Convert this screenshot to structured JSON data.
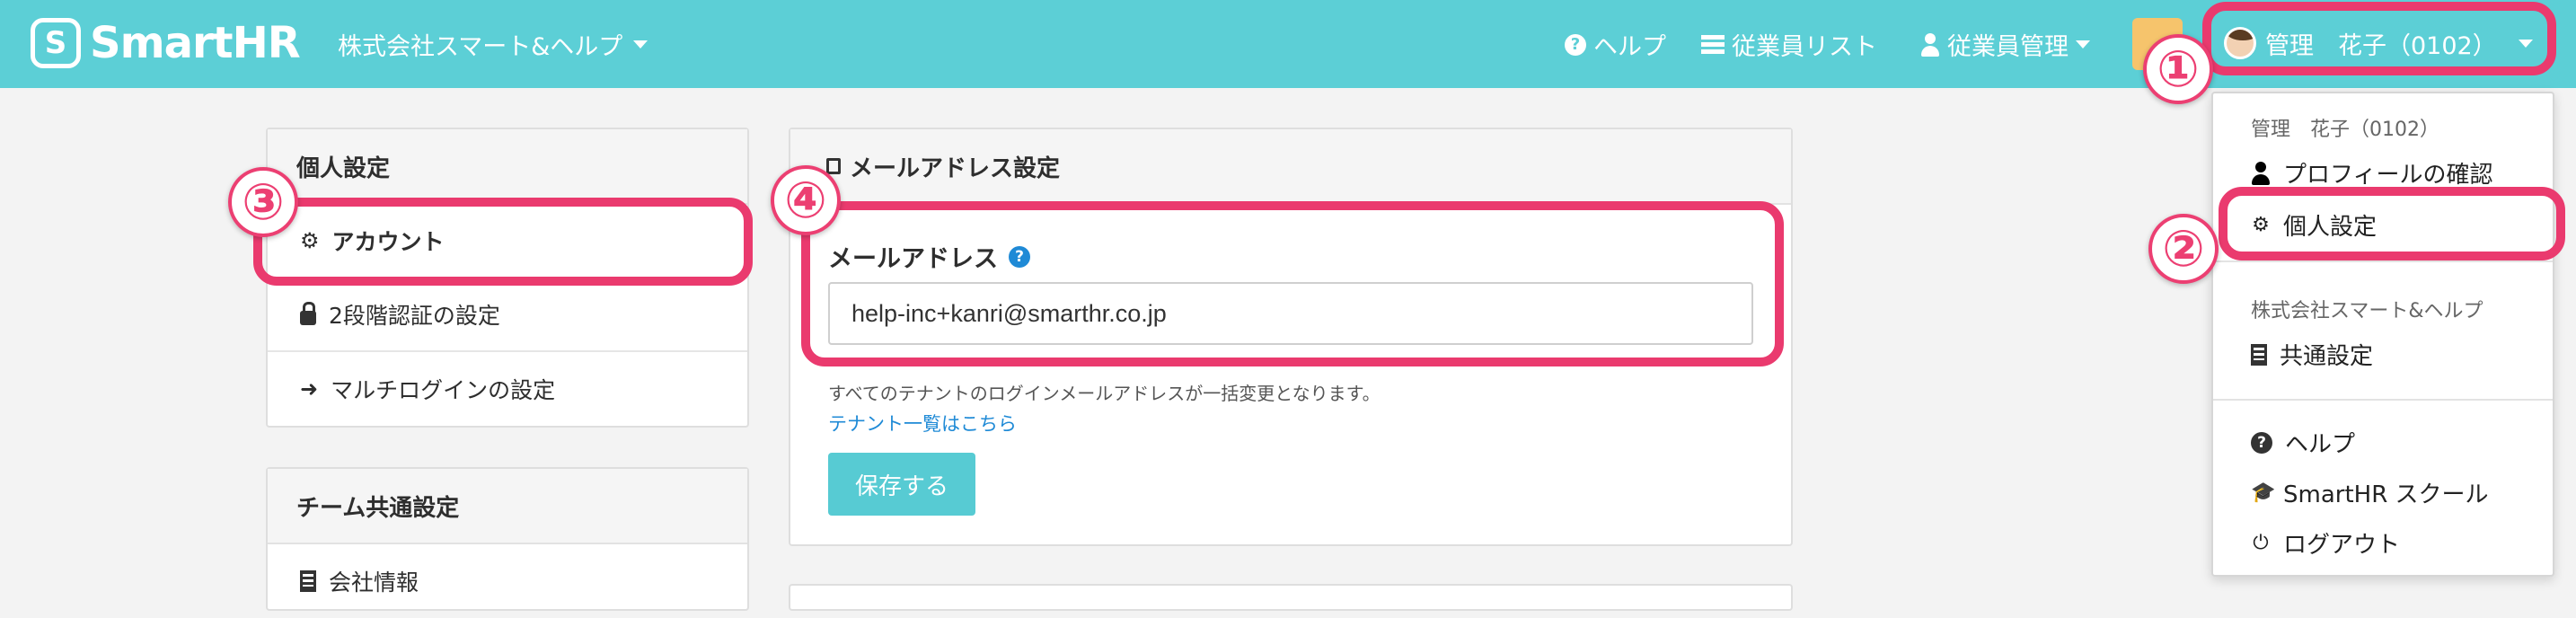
{
  "header": {
    "logo_mark": "S",
    "logo_text": "SmartHR",
    "company": "株式会社スマート&ヘルプ",
    "nav": {
      "help": "ヘルプ",
      "employee_list": "従業員リスト",
      "employee_manage": "従業員管理"
    },
    "user": "管理　花子（0102）"
  },
  "sidebar": {
    "personal_heading": "個人設定",
    "personal_items": [
      {
        "label": "アカウント"
      },
      {
        "label": "2段階認証の設定"
      },
      {
        "label": "マルチログインの設定"
      }
    ],
    "team_heading": "チーム共通設定",
    "team_items": [
      {
        "label": "会社情報"
      }
    ]
  },
  "main": {
    "card_title": "メールアドレス設定",
    "field_label": "メールアドレス",
    "email_value": "help-inc+kanri@smarthr.co.jp",
    "note": "すべてのテナントのログインメールアドレスが一括変更となります。",
    "tenant_link": "テナント一覧はこちら",
    "save_button": "保存する"
  },
  "dropdown": {
    "user_heading": "管理　花子（0102）",
    "profile": "プロフィールの確認",
    "personal_settings": "個人設定",
    "company_heading": "株式会社スマート&ヘルプ",
    "common_settings": "共通設定",
    "help": "ヘルプ",
    "school": "SmartHR スクール",
    "logout": "ログアウト"
  },
  "annotations": {
    "n1": "①",
    "n2": "②",
    "n3": "③",
    "n4": "④"
  },
  "colors": {
    "header_bg": "#5ccfd6",
    "highlight": "#ea3a6e",
    "link": "#1f8ad6",
    "button": "#57cbd3"
  }
}
